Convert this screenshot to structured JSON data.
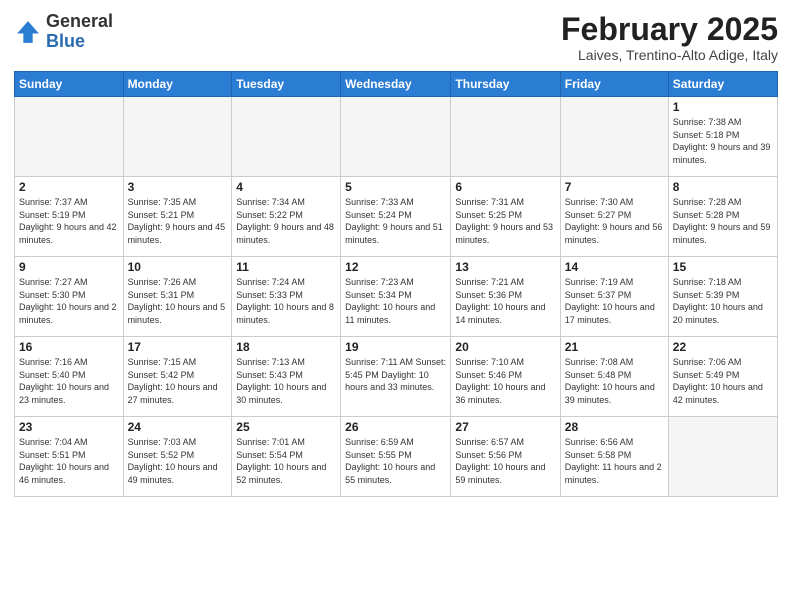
{
  "logo": {
    "general": "General",
    "blue": "Blue"
  },
  "header": {
    "month": "February 2025",
    "location": "Laives, Trentino-Alto Adige, Italy"
  },
  "weekdays": [
    "Sunday",
    "Monday",
    "Tuesday",
    "Wednesday",
    "Thursday",
    "Friday",
    "Saturday"
  ],
  "weeks": [
    [
      {
        "day": "",
        "info": ""
      },
      {
        "day": "",
        "info": ""
      },
      {
        "day": "",
        "info": ""
      },
      {
        "day": "",
        "info": ""
      },
      {
        "day": "",
        "info": ""
      },
      {
        "day": "",
        "info": ""
      },
      {
        "day": "1",
        "info": "Sunrise: 7:38 AM\nSunset: 5:18 PM\nDaylight: 9 hours and 39 minutes."
      }
    ],
    [
      {
        "day": "2",
        "info": "Sunrise: 7:37 AM\nSunset: 5:19 PM\nDaylight: 9 hours and 42 minutes."
      },
      {
        "day": "3",
        "info": "Sunrise: 7:35 AM\nSunset: 5:21 PM\nDaylight: 9 hours and 45 minutes."
      },
      {
        "day": "4",
        "info": "Sunrise: 7:34 AM\nSunset: 5:22 PM\nDaylight: 9 hours and 48 minutes."
      },
      {
        "day": "5",
        "info": "Sunrise: 7:33 AM\nSunset: 5:24 PM\nDaylight: 9 hours and 51 minutes."
      },
      {
        "day": "6",
        "info": "Sunrise: 7:31 AM\nSunset: 5:25 PM\nDaylight: 9 hours and 53 minutes."
      },
      {
        "day": "7",
        "info": "Sunrise: 7:30 AM\nSunset: 5:27 PM\nDaylight: 9 hours and 56 minutes."
      },
      {
        "day": "8",
        "info": "Sunrise: 7:28 AM\nSunset: 5:28 PM\nDaylight: 9 hours and 59 minutes."
      }
    ],
    [
      {
        "day": "9",
        "info": "Sunrise: 7:27 AM\nSunset: 5:30 PM\nDaylight: 10 hours and 2 minutes."
      },
      {
        "day": "10",
        "info": "Sunrise: 7:26 AM\nSunset: 5:31 PM\nDaylight: 10 hours and 5 minutes."
      },
      {
        "day": "11",
        "info": "Sunrise: 7:24 AM\nSunset: 5:33 PM\nDaylight: 10 hours and 8 minutes."
      },
      {
        "day": "12",
        "info": "Sunrise: 7:23 AM\nSunset: 5:34 PM\nDaylight: 10 hours and 11 minutes."
      },
      {
        "day": "13",
        "info": "Sunrise: 7:21 AM\nSunset: 5:36 PM\nDaylight: 10 hours and 14 minutes."
      },
      {
        "day": "14",
        "info": "Sunrise: 7:19 AM\nSunset: 5:37 PM\nDaylight: 10 hours and 17 minutes."
      },
      {
        "day": "15",
        "info": "Sunrise: 7:18 AM\nSunset: 5:39 PM\nDaylight: 10 hours and 20 minutes."
      }
    ],
    [
      {
        "day": "16",
        "info": "Sunrise: 7:16 AM\nSunset: 5:40 PM\nDaylight: 10 hours and 23 minutes."
      },
      {
        "day": "17",
        "info": "Sunrise: 7:15 AM\nSunset: 5:42 PM\nDaylight: 10 hours and 27 minutes."
      },
      {
        "day": "18",
        "info": "Sunrise: 7:13 AM\nSunset: 5:43 PM\nDaylight: 10 hours and 30 minutes."
      },
      {
        "day": "19",
        "info": "Sunrise: 7:11 AM\nSunset: 5:45 PM\nDaylight: 10 hours and 33 minutes."
      },
      {
        "day": "20",
        "info": "Sunrise: 7:10 AM\nSunset: 5:46 PM\nDaylight: 10 hours and 36 minutes."
      },
      {
        "day": "21",
        "info": "Sunrise: 7:08 AM\nSunset: 5:48 PM\nDaylight: 10 hours and 39 minutes."
      },
      {
        "day": "22",
        "info": "Sunrise: 7:06 AM\nSunset: 5:49 PM\nDaylight: 10 hours and 42 minutes."
      }
    ],
    [
      {
        "day": "23",
        "info": "Sunrise: 7:04 AM\nSunset: 5:51 PM\nDaylight: 10 hours and 46 minutes."
      },
      {
        "day": "24",
        "info": "Sunrise: 7:03 AM\nSunset: 5:52 PM\nDaylight: 10 hours and 49 minutes."
      },
      {
        "day": "25",
        "info": "Sunrise: 7:01 AM\nSunset: 5:54 PM\nDaylight: 10 hours and 52 minutes."
      },
      {
        "day": "26",
        "info": "Sunrise: 6:59 AM\nSunset: 5:55 PM\nDaylight: 10 hours and 55 minutes."
      },
      {
        "day": "27",
        "info": "Sunrise: 6:57 AM\nSunset: 5:56 PM\nDaylight: 10 hours and 59 minutes."
      },
      {
        "day": "28",
        "info": "Sunrise: 6:56 AM\nSunset: 5:58 PM\nDaylight: 11 hours and 2 minutes."
      },
      {
        "day": "",
        "info": ""
      }
    ]
  ]
}
